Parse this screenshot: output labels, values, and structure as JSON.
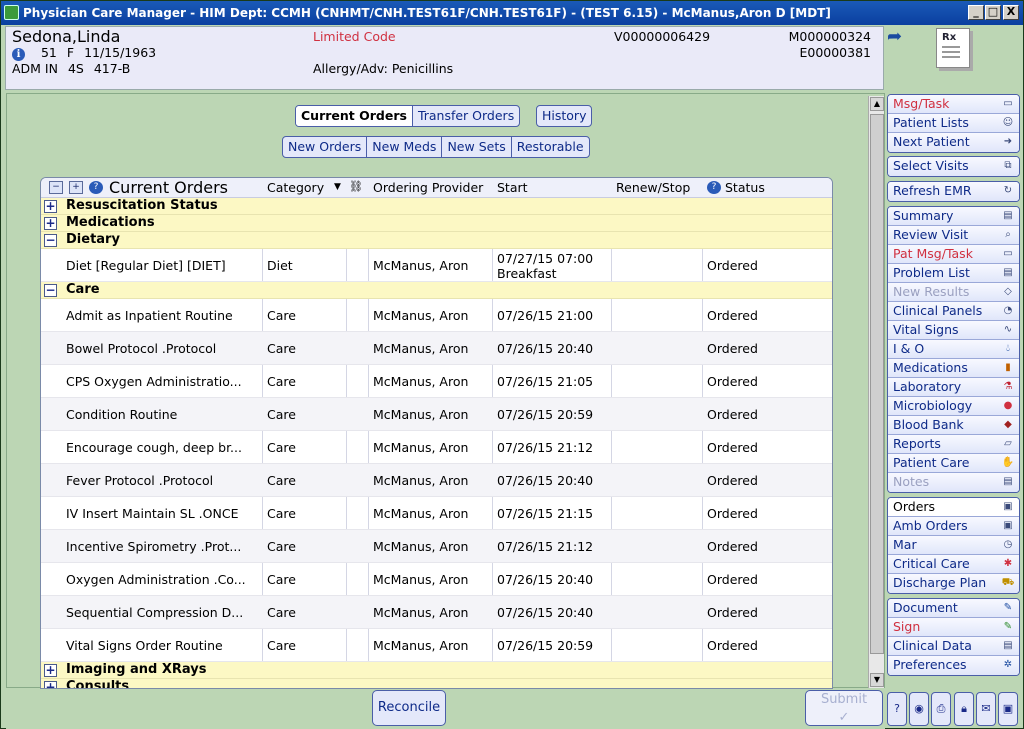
{
  "window": {
    "title": "Physician Care Manager - HIM Dept: CCMH (CNHMT/CNH.TEST61F/CNH.TEST61F) - (TEST 6.15) - McManus,Aron D [MDT]",
    "min": "_",
    "max": "□",
    "close": "X"
  },
  "patient": {
    "name": "Sedona,Linda",
    "age": "51",
    "sex": "F",
    "dob": "11/15/1963",
    "adm": "ADM IN",
    "unit": "4S",
    "room": "417-B",
    "code": "Limited Code",
    "allergy": "Allergy/Adv: Penicillins",
    "visit": "V00000006429",
    "mrn": "M000000324",
    "enc": "E00000381"
  },
  "tabs": {
    "current": "Current Orders",
    "transfer": "Transfer Orders",
    "history": "History"
  },
  "subtabs": {
    "new_orders": "New Orders",
    "new_meds": "New Meds",
    "new_sets": "New Sets",
    "restorable": "Restorable"
  },
  "grid": {
    "title": "Current Orders",
    "headers": {
      "category": "Category",
      "provider": "Ordering Provider",
      "start": "Start",
      "renew": "Renew/Stop",
      "status": "Status"
    }
  },
  "groups": {
    "resus": "Resuscitation Status",
    "meds": "Medications",
    "dietary": "Dietary",
    "care": "Care",
    "imaging": "Imaging and XRays",
    "consults": "Consults"
  },
  "dietary_row": {
    "name": "Diet [Regular Diet] [DIET]",
    "category": "Diet",
    "provider": "McManus, Aron",
    "start1": "07/27/15 07:00",
    "start2": "Breakfast",
    "renew": "",
    "status": "Ordered"
  },
  "care_rows": [
    {
      "name": "Admit as Inpatient Routine",
      "category": "Care",
      "provider": "McManus, Aron",
      "start": "07/26/15 21:00",
      "renew": "",
      "status": "Ordered"
    },
    {
      "name": "Bowel Protocol .Protocol",
      "category": "Care",
      "provider": "McManus, Aron",
      "start": "07/26/15 20:40",
      "renew": "",
      "status": "Ordered"
    },
    {
      "name": "CPS Oxygen Administratio...",
      "category": "Care",
      "provider": "McManus, Aron",
      "start": "07/26/15 21:05",
      "renew": "",
      "status": "Ordered"
    },
    {
      "name": "Condition Routine",
      "category": "Care",
      "provider": "McManus, Aron",
      "start": "07/26/15 20:59",
      "renew": "",
      "status": "Ordered"
    },
    {
      "name": "Encourage cough, deep br...",
      "category": "Care",
      "provider": "McManus, Aron",
      "start": "07/26/15 21:12",
      "renew": "",
      "status": "Ordered"
    },
    {
      "name": "Fever Protocol .Protocol",
      "category": "Care",
      "provider": "McManus, Aron",
      "start": "07/26/15 20:40",
      "renew": "",
      "status": "Ordered"
    },
    {
      "name": "IV Insert Maintain SL .ONCE",
      "category": "Care",
      "provider": "McManus, Aron",
      "start": "07/26/15 21:15",
      "renew": "",
      "status": "Ordered"
    },
    {
      "name": "Incentive Spirometry .Prot...",
      "category": "Care",
      "provider": "McManus, Aron",
      "start": "07/26/15 21:12",
      "renew": "",
      "status": "Ordered"
    },
    {
      "name": "Oxygen Administration .Co...",
      "category": "Care",
      "provider": "McManus, Aron",
      "start": "07/26/15 20:40",
      "renew": "",
      "status": "Ordered"
    },
    {
      "name": "Sequential Compression D...",
      "category": "Care",
      "provider": "McManus, Aron",
      "start": "07/26/15 20:40",
      "renew": "",
      "status": "Ordered"
    },
    {
      "name": "Vital Signs Order Routine",
      "category": "Care",
      "provider": "McManus, Aron",
      "start": "07/26/15 20:59",
      "renew": "",
      "status": "Ordered"
    }
  ],
  "buttons": {
    "reconcile": "Reconcile",
    "submit": "Submit"
  },
  "nav": {
    "g1": [
      "Msg/Task",
      "Patient Lists",
      "Next Patient"
    ],
    "g2": [
      "Select Visits"
    ],
    "g3": [
      "Refresh EMR"
    ],
    "g4": [
      "Summary",
      "Review Visit",
      "Pat Msg/Task",
      "Problem List",
      "New Results",
      "Clinical Panels",
      "Vital Signs",
      "I & O",
      "Medications",
      "Laboratory",
      "Microbiology",
      "Blood Bank",
      "Reports",
      "Patient Care",
      "Notes"
    ],
    "g5": [
      "Orders",
      "Amb Orders",
      "Mar",
      "Critical Care",
      "Discharge Plan"
    ],
    "g6": [
      "Document",
      "Sign",
      "Clinical Data",
      "Preferences"
    ]
  },
  "rx": "Rx"
}
